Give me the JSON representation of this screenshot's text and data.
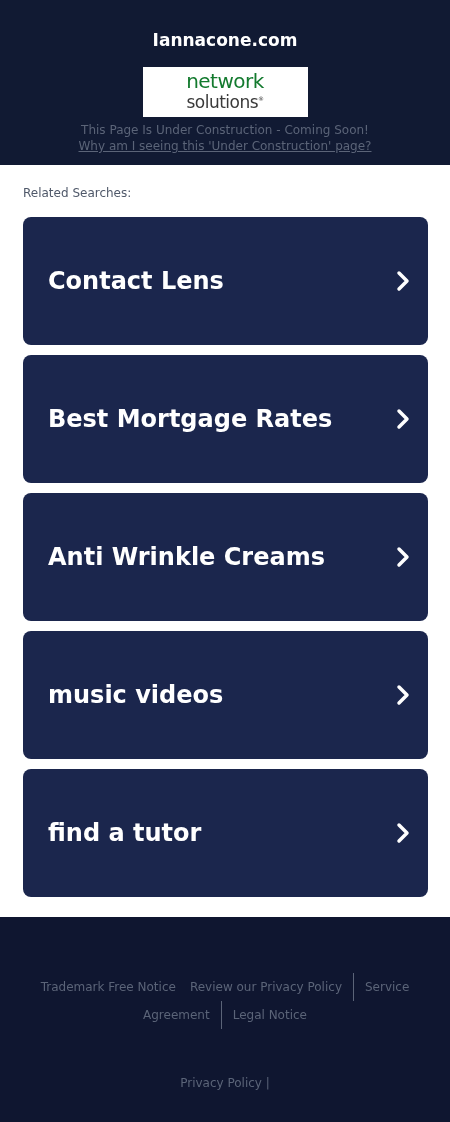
{
  "header": {
    "domain": "Iannacone.com",
    "logo": {
      "line_1": "network",
      "line_2": "solutions",
      "mark": "®"
    },
    "notice": "This Page Is Under Construction - Coming Soon!",
    "why_link": "Why am I seeing this 'Under Construction' page?"
  },
  "related": {
    "title": "Related Searches:",
    "items": [
      {
        "label": "Contact Lens"
      },
      {
        "label": "Best Mortgage Rates"
      },
      {
        "label": "Anti Wrinkle Creams"
      },
      {
        "label": "music videos"
      },
      {
        "label": "find a tutor"
      }
    ]
  },
  "footer": {
    "links": [
      {
        "label": "Trademark Free Notice",
        "separated": false
      },
      {
        "label": "Review our Privacy Policy",
        "separated": false
      },
      {
        "label": "Service",
        "separated": true
      },
      {
        "label": "Agreement",
        "separated": false
      },
      {
        "label": "Legal Notice",
        "separated": true
      }
    ],
    "bottom": "Privacy Policy |"
  }
}
